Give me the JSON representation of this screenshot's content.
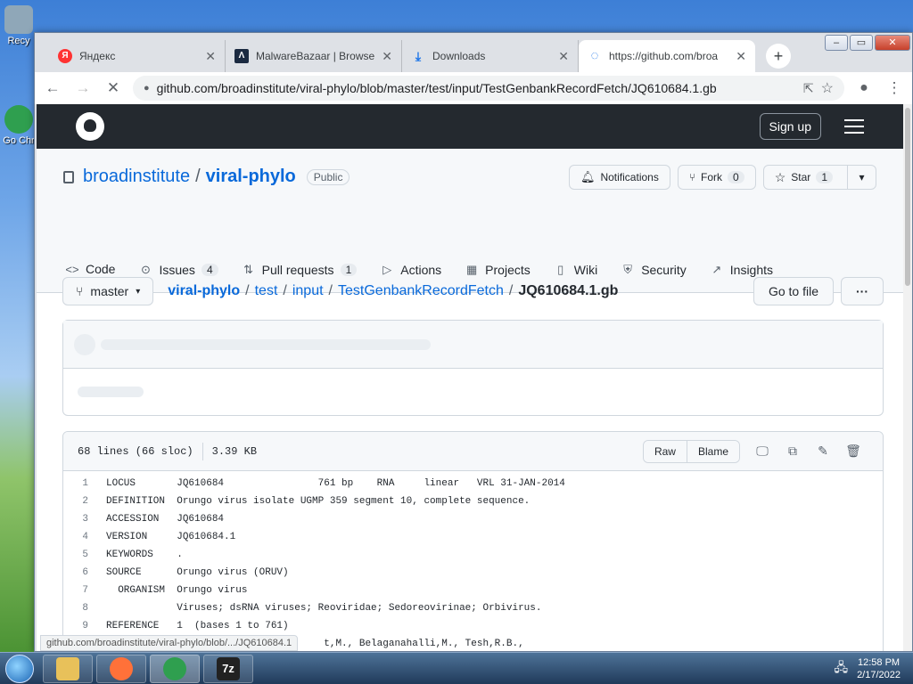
{
  "desktop": {
    "icons": [
      {
        "label": "Recy",
        "color": "#8fa7b8"
      },
      {
        "label": "Go Chr",
        "color": "#2f9f4f"
      }
    ]
  },
  "browser": {
    "window_controls": {
      "minimize": "–",
      "maximize": "▭",
      "close": "✕"
    },
    "tabs": [
      {
        "title": "Яндекс",
        "favicon": "Я",
        "favicon_color": "#f33",
        "close": "✕",
        "active": false
      },
      {
        "title": "MalwareBazaar | Browse",
        "favicon": "Λ",
        "favicon_color": "#1b2a41",
        "close": "✕",
        "active": false
      },
      {
        "title": "Downloads",
        "favicon": "⤓",
        "favicon_color": "#1a73e8",
        "close": "✕",
        "active": false
      },
      {
        "title": "https://github.com/broa",
        "favicon": "◌",
        "favicon_color": "#1a73e8",
        "close": "✕",
        "active": true
      }
    ],
    "new_tab": "+",
    "toolbar": {
      "back": "←",
      "forward": "→",
      "reload": "✕",
      "url": "github.com/broadinstitute/viral-phylo/blob/master/test/input/TestGenbankRecordFetch/JQ610684.1.gb"
    },
    "status_url": "github.com/broadinstitute/viral-phylo/blob/.../JQ610684.1"
  },
  "github": {
    "header": {
      "signup": "Sign up"
    },
    "repo": {
      "owner": "broadinstitute",
      "separator": "/",
      "name": "viral-phylo",
      "visibility": "Public"
    },
    "actions": {
      "notifications": "Notifications",
      "fork": "Fork",
      "fork_count": "0",
      "star": "Star",
      "star_count": "1"
    },
    "nav": [
      {
        "label": "Code",
        "icon": "<>",
        "count": ""
      },
      {
        "label": "Issues",
        "icon": "⊙",
        "count": "4"
      },
      {
        "label": "Pull requests",
        "icon": "⇅",
        "count": "1"
      },
      {
        "label": "Actions",
        "icon": "▷",
        "count": ""
      },
      {
        "label": "Projects",
        "icon": "▦",
        "count": ""
      },
      {
        "label": "Wiki",
        "icon": "▯",
        "count": ""
      },
      {
        "label": "Security",
        "icon": "⛨",
        "count": ""
      },
      {
        "label": "Insights",
        "icon": "↗",
        "count": ""
      }
    ],
    "file": {
      "branch": "master",
      "crumbs": [
        "viral-phylo",
        "test",
        "input",
        "TestGenbankRecordFetch"
      ],
      "filename": "JQ610684.1.gb",
      "go_to_file": "Go to file",
      "more": "···"
    },
    "code": {
      "lines_info": "68 lines (66 sloc)",
      "size": "3.39 KB",
      "raw": "Raw",
      "blame": "Blame",
      "lines": [
        {
          "n": "1",
          "text": "LOCUS       JQ610684                761 bp    RNA     linear   VRL 31-JAN-2014"
        },
        {
          "n": "2",
          "text": "DEFINITION  Orungo virus isolate UGMP 359 segment 10, complete sequence."
        },
        {
          "n": "3",
          "text": "ACCESSION   JQ610684"
        },
        {
          "n": "4",
          "text": "VERSION     JQ610684.1"
        },
        {
          "n": "5",
          "text": "KEYWORDS    ."
        },
        {
          "n": "6",
          "text": "SOURCE      Orungo virus (ORUV)"
        },
        {
          "n": "7",
          "text": "  ORGANISM  Orungo virus"
        },
        {
          "n": "8",
          "text": "            Viruses; dsRNA viruses; Reoviridae; Sedoreovirinae; Orbivirus."
        },
        {
          "n": "9",
          "text": "REFERENCE   1  (bases 1 to 761)"
        },
        {
          "n": "",
          "text": "                                     t,M., Belaganahalli,M., Tesh,R.B.,"
        }
      ]
    }
  },
  "taskbar": {
    "apps": [
      {
        "name": "explorer",
        "color": "#e8c15a"
      },
      {
        "name": "firefox",
        "color": "#ff7139"
      },
      {
        "name": "chrome",
        "color": "#2f9f4f"
      },
      {
        "name": "7zip",
        "label": "7z",
        "color": "#222"
      }
    ],
    "time": "12:58 PM",
    "date": "2/17/2022"
  }
}
